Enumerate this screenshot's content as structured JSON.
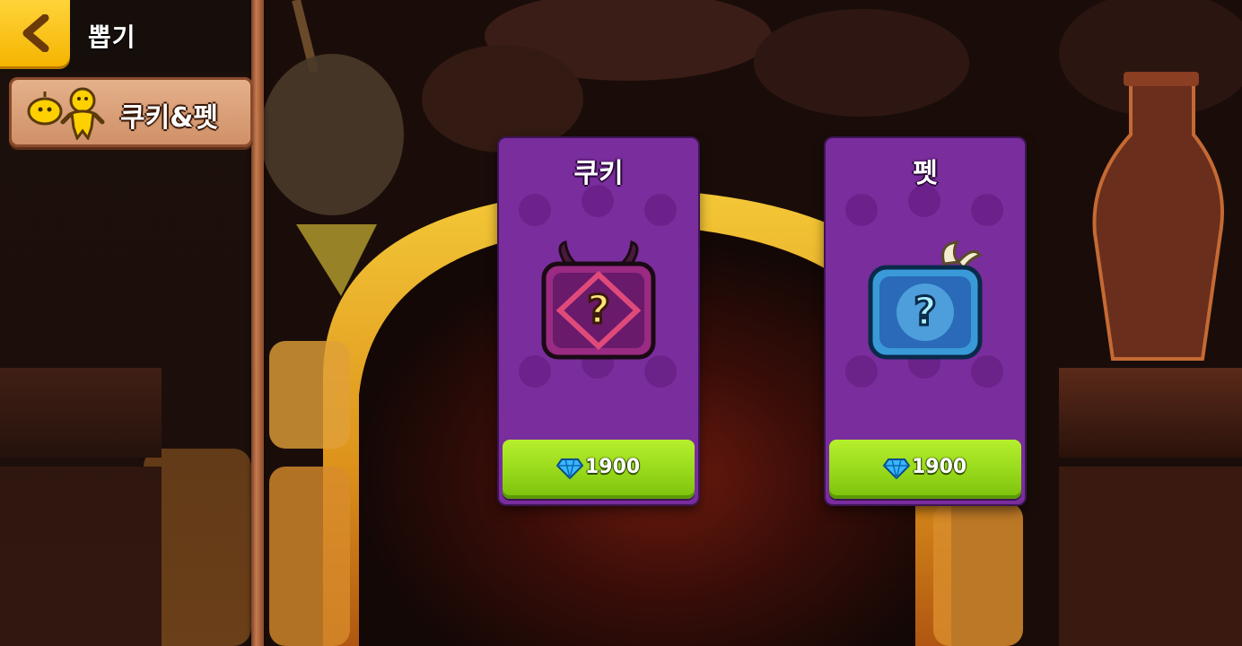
{
  "header": {
    "back_icon": "chevron-left-icon",
    "title": "뽑기"
  },
  "sidebar": {
    "active_tab": {
      "label": "쿠키&펫",
      "icon": "cookie-pet-icon"
    }
  },
  "cards": [
    {
      "title": "쿠키",
      "box_icon": "purple-horned-mystery-box-icon",
      "price": "1900",
      "currency_icon": "diamond-icon"
    },
    {
      "title": "펫",
      "box_icon": "blue-winged-mystery-box-icon",
      "price": "1900",
      "currency_icon": "diamond-icon"
    }
  ],
  "colors": {
    "accent_yellow": "#f5b400",
    "card_purple": "#7a2d9c",
    "buy_green": "#97d81a",
    "panel_tan": "#cf8f66"
  }
}
